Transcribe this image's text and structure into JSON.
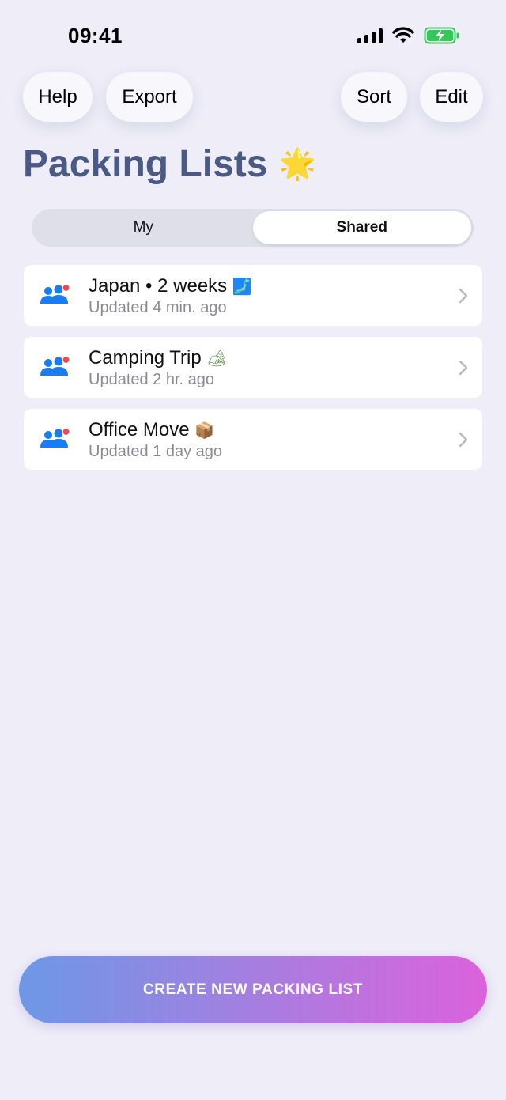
{
  "status_bar": {
    "time": "09:41"
  },
  "toolbar": {
    "help_label": "Help",
    "export_label": "Export",
    "sort_label": "Sort",
    "edit_label": "Edit"
  },
  "page": {
    "title": "Packing Lists",
    "title_emoji": "🌟"
  },
  "segmented": {
    "my_label": "My",
    "shared_label": "Shared",
    "selected": "Shared"
  },
  "lists": [
    {
      "title": "Japan • 2 weeks",
      "emoji": "🗾",
      "updated": "Updated 4 min. ago",
      "icon": "shared-people-icon"
    },
    {
      "title": "Camping Trip",
      "emoji": "🏕",
      "updated": "Updated 2 hr. ago",
      "icon": "shared-people-icon"
    },
    {
      "title": "Office Move",
      "emoji": "📦",
      "updated": "Updated 1 day ago",
      "icon": "shared-people-icon"
    }
  ],
  "cta": {
    "label": "CREATE NEW PACKING LIST"
  },
  "colors": {
    "background": "#eeedf8",
    "title": "#4a5a85",
    "people_icon": "#1a7cf5",
    "badge": "#f0474f",
    "cta_gradient_start": "#6d98e6",
    "cta_gradient_end": "#dc62dc",
    "battery": "#35c759"
  }
}
